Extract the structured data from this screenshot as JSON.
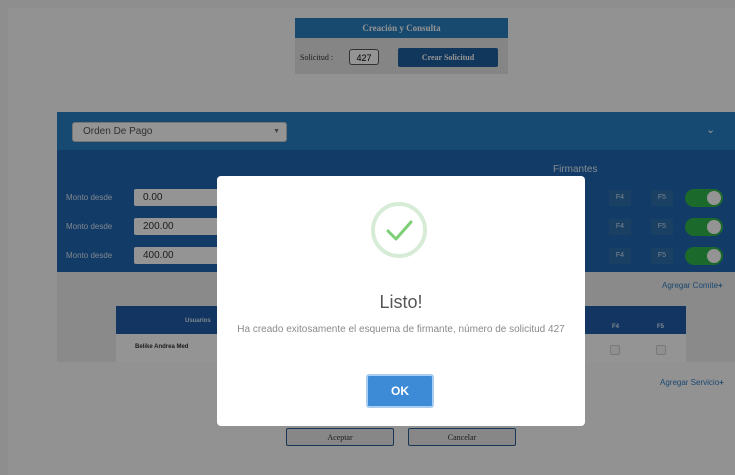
{
  "top_panel": {
    "title": "Creación y Consulta",
    "solicitud_label": "Solicitud :",
    "solicitud_value": "427",
    "crear_button": "Crear Solicitud"
  },
  "config": {
    "tipo_select": "Orden De Pago",
    "firmantes_label": "Firmantes",
    "rows": [
      {
        "label": "Monto desde",
        "value": "0.00",
        "f4": "F4",
        "f5": "F5"
      },
      {
        "label": "Monto desde",
        "value": "200.00",
        "f4": "F4",
        "f5": "F5"
      },
      {
        "label": "Monto desde",
        "value": "400.00",
        "f4": "F4",
        "f5": "F5"
      }
    ],
    "agregar_comite": "Agregar Comite",
    "agregar_servicio": "Agregar Servicio"
  },
  "table": {
    "header_user": "Usuarios",
    "header_f4": "F4",
    "header_f5": "F5",
    "rows": [
      {
        "name": "Belike Andrea Med"
      }
    ]
  },
  "buttons": {
    "aceptar": "Aceptar",
    "cancelar": "Cancelar"
  },
  "modal": {
    "title": "Listo!",
    "message": "Ha creado exitosamente el esquema de firmante, número de solicitud 427",
    "ok": "OK"
  },
  "colors": {
    "accent": "#2980c4",
    "dark_blue": "#1f67b2",
    "toggle_on": "#2fb54a",
    "success": "#4caf50"
  }
}
